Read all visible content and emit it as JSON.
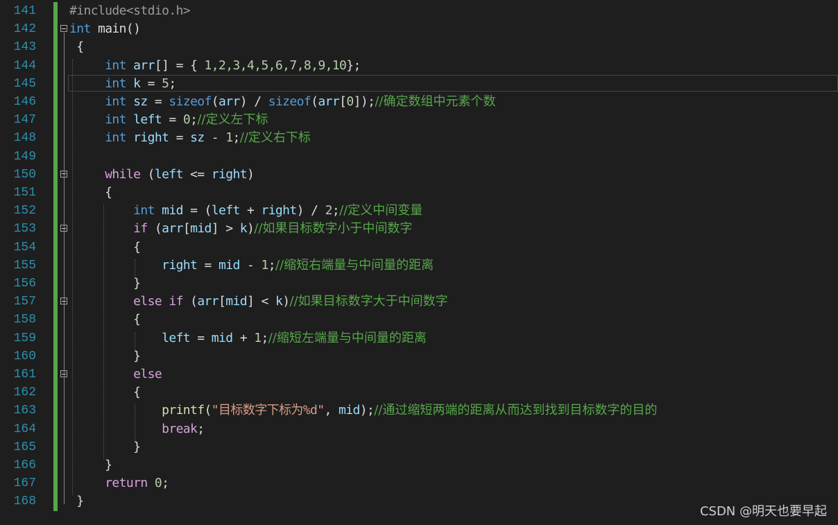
{
  "editor": {
    "lines": [
      {
        "n": "141",
        "tokens": [
          [
            "pp",
            "#include<stdio.h>"
          ]
        ]
      },
      {
        "n": "142",
        "tokens": [
          [
            "kw",
            "int"
          ],
          [
            "",
            " main()"
          ]
        ]
      },
      {
        "n": "143",
        "tokens": [
          [
            "",
            " {"
          ]
        ]
      },
      {
        "n": "144",
        "tokens": [
          [
            "",
            "     "
          ],
          [
            "kw",
            "int"
          ],
          [
            "",
            " "
          ],
          [
            "var",
            "arr"
          ],
          [
            "",
            "[] = { "
          ],
          [
            "num",
            "1,2,3,4,5,6,7,8,9,10"
          ],
          [
            "",
            "};"
          ]
        ]
      },
      {
        "n": "145",
        "tokens": [
          [
            "",
            "     "
          ],
          [
            "kw",
            "int"
          ],
          [
            "",
            " "
          ],
          [
            "var",
            "k"
          ],
          [
            "",
            " = "
          ],
          [
            "num",
            "5"
          ],
          [
            "",
            ";"
          ]
        ]
      },
      {
        "n": "146",
        "tokens": [
          [
            "",
            "     "
          ],
          [
            "kw",
            "int"
          ],
          [
            "",
            " "
          ],
          [
            "var",
            "sz"
          ],
          [
            "",
            " = "
          ],
          [
            "kw",
            "sizeof"
          ],
          [
            "",
            "("
          ],
          [
            "var",
            "arr"
          ],
          [
            "",
            ") / "
          ],
          [
            "kw",
            "sizeof"
          ],
          [
            "",
            "("
          ],
          [
            "var",
            "arr"
          ],
          [
            "",
            "["
          ],
          [
            "num",
            "0"
          ],
          [
            "",
            "]);"
          ],
          [
            "cm",
            "//确定数组中元素个数"
          ]
        ]
      },
      {
        "n": "147",
        "tokens": [
          [
            "",
            "     "
          ],
          [
            "kw",
            "int"
          ],
          [
            "",
            " "
          ],
          [
            "var",
            "left"
          ],
          [
            "",
            " = "
          ],
          [
            "num",
            "0"
          ],
          [
            "",
            ";"
          ],
          [
            "cm",
            "//定义左下标"
          ]
        ]
      },
      {
        "n": "148",
        "tokens": [
          [
            "",
            "     "
          ],
          [
            "kw",
            "int"
          ],
          [
            "",
            " "
          ],
          [
            "var",
            "right"
          ],
          [
            "",
            " = "
          ],
          [
            "var",
            "sz"
          ],
          [
            "",
            " - "
          ],
          [
            "num",
            "1"
          ],
          [
            "",
            ";"
          ],
          [
            "cm",
            "//定义右下标"
          ]
        ]
      },
      {
        "n": "149",
        "tokens": []
      },
      {
        "n": "150",
        "tokens": [
          [
            "",
            "     "
          ],
          [
            "ctl",
            "while"
          ],
          [
            "",
            " ("
          ],
          [
            "var",
            "left"
          ],
          [
            "",
            " <= "
          ],
          [
            "var",
            "right"
          ],
          [
            "",
            ")"
          ]
        ]
      },
      {
        "n": "151",
        "tokens": [
          [
            "",
            "     {"
          ]
        ]
      },
      {
        "n": "152",
        "tokens": [
          [
            "",
            "         "
          ],
          [
            "kw",
            "int"
          ],
          [
            "",
            " "
          ],
          [
            "var",
            "mid"
          ],
          [
            "",
            " = ("
          ],
          [
            "var",
            "left"
          ],
          [
            "",
            " + "
          ],
          [
            "var",
            "right"
          ],
          [
            "",
            ") / "
          ],
          [
            "num",
            "2"
          ],
          [
            "",
            ";"
          ],
          [
            "cm",
            "//定义中间变量"
          ]
        ]
      },
      {
        "n": "153",
        "tokens": [
          [
            "",
            "         "
          ],
          [
            "ctl",
            "if"
          ],
          [
            "",
            " ("
          ],
          [
            "var",
            "arr"
          ],
          [
            "",
            "["
          ],
          [
            "var",
            "mid"
          ],
          [
            "",
            "] > "
          ],
          [
            "var",
            "k"
          ],
          [
            "",
            ")"
          ],
          [
            "cm",
            "//如果目标数字小于中间数字"
          ]
        ]
      },
      {
        "n": "154",
        "tokens": [
          [
            "",
            "         {"
          ]
        ]
      },
      {
        "n": "155",
        "tokens": [
          [
            "",
            "             "
          ],
          [
            "var",
            "right"
          ],
          [
            "",
            " = "
          ],
          [
            "var",
            "mid"
          ],
          [
            "",
            " - "
          ],
          [
            "num",
            "1"
          ],
          [
            "",
            ";"
          ],
          [
            "cm",
            "//缩短右端量与中间量的距离"
          ]
        ]
      },
      {
        "n": "156",
        "tokens": [
          [
            "",
            "         }"
          ]
        ]
      },
      {
        "n": "157",
        "tokens": [
          [
            "",
            "         "
          ],
          [
            "ctl",
            "else"
          ],
          [
            "",
            " "
          ],
          [
            "ctl",
            "if"
          ],
          [
            "",
            " ("
          ],
          [
            "var",
            "arr"
          ],
          [
            "",
            "["
          ],
          [
            "var",
            "mid"
          ],
          [
            "",
            "] < "
          ],
          [
            "var",
            "k"
          ],
          [
            "",
            ")"
          ],
          [
            "cm",
            "//如果目标数字大于中间数字"
          ]
        ]
      },
      {
        "n": "158",
        "tokens": [
          [
            "",
            "         {"
          ]
        ]
      },
      {
        "n": "159",
        "tokens": [
          [
            "",
            "             "
          ],
          [
            "var",
            "left"
          ],
          [
            "",
            " = "
          ],
          [
            "var",
            "mid"
          ],
          [
            "",
            " + "
          ],
          [
            "num",
            "1"
          ],
          [
            "",
            ";"
          ],
          [
            "cm",
            "//缩短左端量与中间量的距离"
          ]
        ]
      },
      {
        "n": "160",
        "tokens": [
          [
            "",
            "         }"
          ]
        ]
      },
      {
        "n": "161",
        "tokens": [
          [
            "",
            "         "
          ],
          [
            "ctl",
            "else"
          ]
        ]
      },
      {
        "n": "162",
        "tokens": [
          [
            "",
            "         {"
          ]
        ]
      },
      {
        "n": "163",
        "tokens": [
          [
            "",
            "             "
          ],
          [
            "fn",
            "printf"
          ],
          [
            "",
            "("
          ],
          [
            "str",
            "\"目标数字下标为%d\""
          ],
          [
            "",
            ", "
          ],
          [
            "var",
            "mid"
          ],
          [
            "",
            ");"
          ],
          [
            "cm",
            "//通过缩短两端的距离从而达到找到目标数字的目的"
          ]
        ]
      },
      {
        "n": "164",
        "tokens": [
          [
            "",
            "             "
          ],
          [
            "ctl",
            "break"
          ],
          [
            "",
            ";"
          ]
        ]
      },
      {
        "n": "165",
        "tokens": [
          [
            "",
            "         }"
          ]
        ]
      },
      {
        "n": "166",
        "tokens": [
          [
            "",
            "     }"
          ]
        ]
      },
      {
        "n": "167",
        "tokens": [
          [
            "",
            "     "
          ],
          [
            "ctl",
            "return"
          ],
          [
            "",
            " "
          ],
          [
            "num",
            "0"
          ],
          [
            "",
            ";"
          ]
        ]
      },
      {
        "n": "168",
        "tokens": [
          [
            "",
            " }"
          ]
        ]
      }
    ],
    "fold_lines": [
      "142",
      "150",
      "153",
      "157",
      "161"
    ],
    "current_line": "145"
  },
  "watermark": "CSDN @明天也要早起",
  "colors": {
    "background": "#1e1e1e",
    "keyword": "#569cd6",
    "control": "#d8a0df",
    "comment": "#57a64a",
    "line_number": "#2b91af"
  }
}
